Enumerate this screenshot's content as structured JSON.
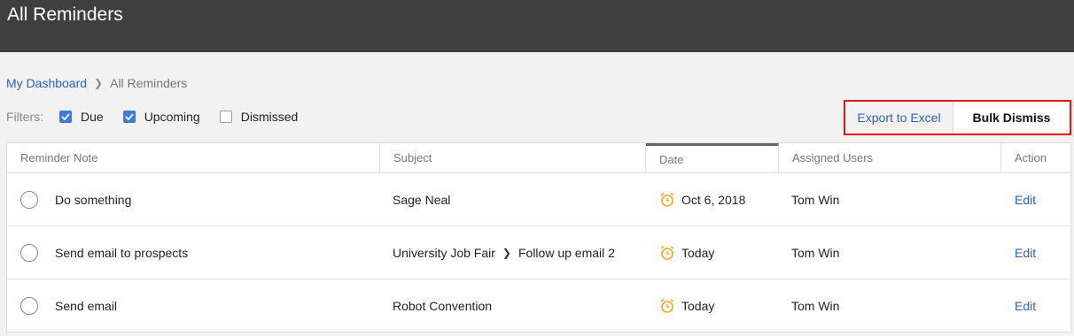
{
  "header": {
    "title": "All Reminders"
  },
  "breadcrumb": {
    "home": "My Dashboard",
    "current": "All Reminders"
  },
  "filters": {
    "label": "Filters:",
    "items": [
      {
        "label": "Due",
        "checked": true
      },
      {
        "label": "Upcoming",
        "checked": true
      },
      {
        "label": "Dismissed",
        "checked": false
      }
    ]
  },
  "actions": {
    "export_label": "Export to Excel",
    "bulk_dismiss_label": "Bulk Dismiss"
  },
  "table": {
    "columns": [
      "Reminder Note",
      "Subject",
      "Date",
      "Assigned Users",
      "Action"
    ],
    "rows": [
      {
        "note": "Do something",
        "subject": "Sage Neal",
        "subject_sub": "",
        "date": "Oct 6, 2018",
        "user": "Tom Win",
        "action": "Edit"
      },
      {
        "note": "Send email to prospects",
        "subject": "University Job Fair",
        "subject_sub": "Follow up email 2",
        "date": "Today",
        "user": "Tom Win",
        "action": "Edit"
      },
      {
        "note": "Send email",
        "subject": "Robot Convention",
        "subject_sub": "",
        "date": "Today",
        "user": "Tom Win",
        "action": "Edit"
      }
    ]
  },
  "colors": {
    "topbar": "#3f3f3f",
    "link": "#2a62c9",
    "highlight": "#e8141b",
    "checkbox": "#3b7ddd",
    "clock": "#f5a623"
  },
  "icons": {
    "breadcrumb_separator": "chevron-right-icon",
    "date": "alarm-clock-icon"
  }
}
